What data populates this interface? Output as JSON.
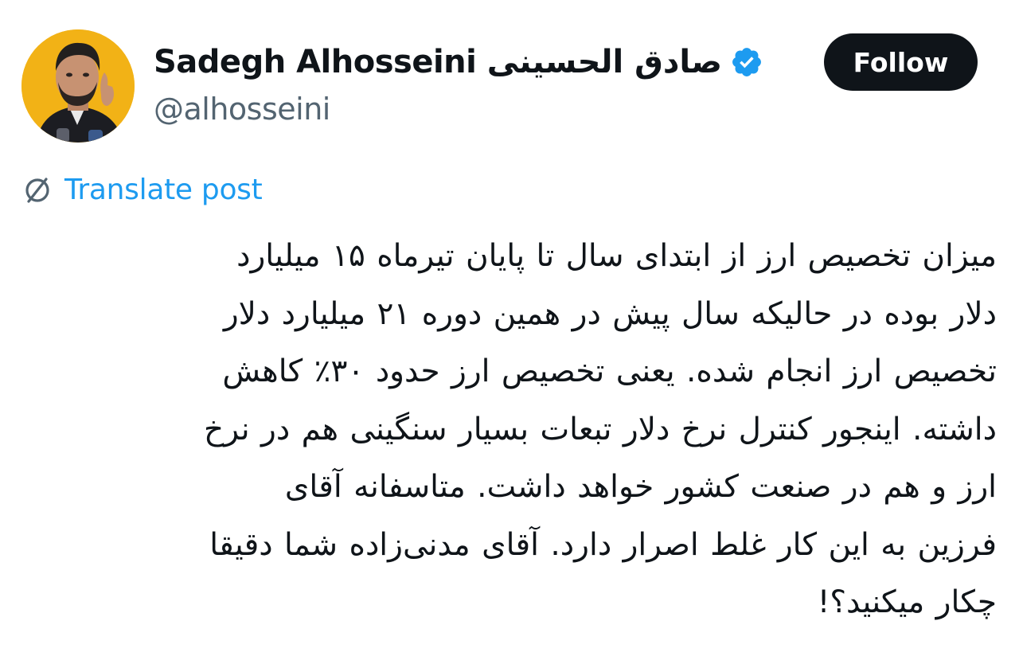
{
  "author": {
    "display_name": "Sadegh Alhosseini صادق الحسینی",
    "handle": "@alhosseini",
    "verified": true
  },
  "follow_button": {
    "label": "Follow"
  },
  "translate": {
    "label": "Translate post"
  },
  "post": {
    "lines": [
      "میزان تخصیص ارز از ابتدای سال تا پایان تیرماه ۱۵ میلیارد",
      "دلار بوده در حالیکه سال پیش در همین دوره ۲۱ میلیارد دلار",
      "تخصیص ارز انجام شده. یعنی تخصیص ارز حدود ۳۰٪ کاهش",
      "داشته. اینجور کنترل نرخ دلار تبعات بسیار سنگینی هم در نرخ",
      "ارز و هم در صنعت کشور خواهد داشت. متاسفانه آقای",
      "فرزین به این کار غلط اصرار دارد. آقای مدنی‌زاده شما دقیقا",
      "چکار میکنید؟!"
    ]
  },
  "colors": {
    "text": "#0f1419",
    "secondary": "#536471",
    "accent": "#1d9bf0",
    "button_bg": "#0f1419",
    "avatar_bg": "#f2b216"
  },
  "icons": {
    "verified": "verified-badge-icon",
    "translate": "translate-globe-icon"
  }
}
